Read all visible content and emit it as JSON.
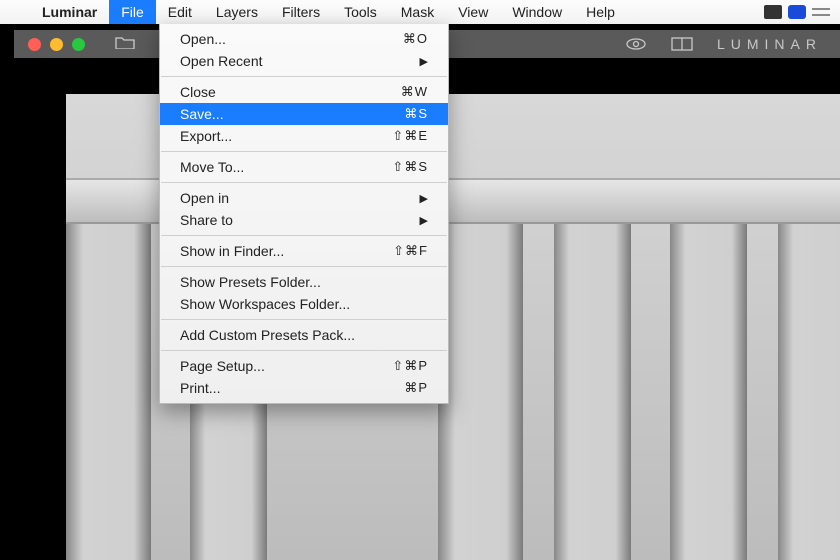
{
  "menubar": {
    "app": "Luminar",
    "items": [
      "File",
      "Edit",
      "Layers",
      "Filters",
      "Tools",
      "Mask",
      "View",
      "Window",
      "Help"
    ],
    "active_index": 0
  },
  "dropdown": {
    "groups": [
      [
        {
          "label": "Open...",
          "shortcut": "⌘O",
          "submenu": false
        },
        {
          "label": "Open Recent",
          "shortcut": "",
          "submenu": true
        }
      ],
      [
        {
          "label": "Close",
          "shortcut": "⌘W",
          "submenu": false
        },
        {
          "label": "Save...",
          "shortcut": "⌘S",
          "submenu": false,
          "highlight": true
        },
        {
          "label": "Export...",
          "shortcut": "⇧⌘E",
          "submenu": false
        }
      ],
      [
        {
          "label": "Move To...",
          "shortcut": "⇧⌘S",
          "submenu": false
        }
      ],
      [
        {
          "label": "Open in",
          "shortcut": "",
          "submenu": true
        },
        {
          "label": "Share to",
          "shortcut": "",
          "submenu": true
        }
      ],
      [
        {
          "label": "Show in Finder...",
          "shortcut": "⇧⌘F",
          "submenu": false
        }
      ],
      [
        {
          "label": "Show Presets Folder...",
          "shortcut": "",
          "submenu": false
        },
        {
          "label": "Show Workspaces Folder...",
          "shortcut": "",
          "submenu": false
        }
      ],
      [
        {
          "label": "Add Custom Presets Pack...",
          "shortcut": "",
          "submenu": false
        }
      ],
      [
        {
          "label": "Page Setup...",
          "shortcut": "⇧⌘P",
          "submenu": false
        },
        {
          "label": "Print...",
          "shortcut": "⌘P",
          "submenu": false
        }
      ]
    ]
  },
  "window": {
    "brand": "LUMINAR"
  }
}
